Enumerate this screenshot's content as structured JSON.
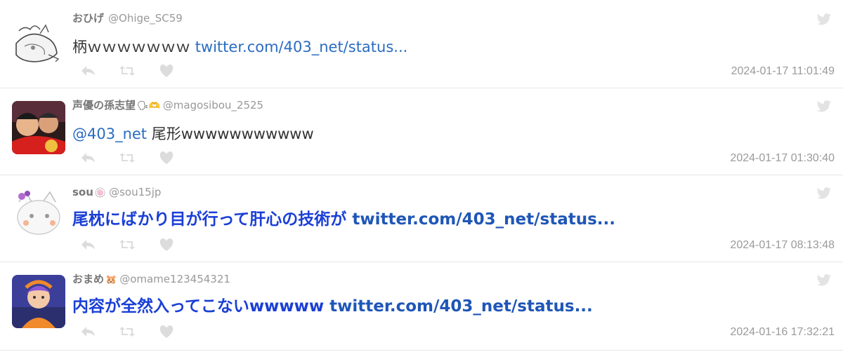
{
  "tweets": [
    {
      "name": "おひげ",
      "name_emoji": "",
      "handle": "@Ohige_SC59",
      "text_plain": "柄ｗｗｗｗｗｗｗ",
      "mention": "",
      "link": "twitter.com/403_net/status...",
      "timestamp": "2024-01-17 11:01:49"
    },
    {
      "name": "声優の孫志望",
      "name_emoji": "🗣🫶",
      "handle": "@magosibou_2525",
      "mention": "@403_net",
      "text_plain": " 尾形wwwwwwwwwww",
      "link": "",
      "timestamp": "2024-01-17 01:30:40"
    },
    {
      "name": "sou",
      "name_emoji": "🍥",
      "handle": "@sou15jp",
      "text_plain": "尾枕にばかり目が行って肝心の技術が ",
      "mention": "",
      "link": "twitter.com/403_net/status...",
      "timestamp": "2024-01-17 08:13:48"
    },
    {
      "name": "おまめ",
      "name_emoji": "🐹",
      "handle": "@omame123454321",
      "text_plain": "内容が全然入ってこないwwwww ",
      "mention": "",
      "link": "twitter.com/403_net/status...",
      "timestamp": "2024-01-16 17:32:21"
    }
  ],
  "icons": {
    "reply": "reply-icon",
    "retweet": "retweet-icon",
    "like": "heart-icon",
    "brand": "twitter-bird-icon"
  },
  "colors": {
    "link": "#2a6cc1",
    "big_text": "#1a3fd6",
    "icon_gray": "#d9d9d9",
    "timestamp": "#9a9a9a"
  }
}
